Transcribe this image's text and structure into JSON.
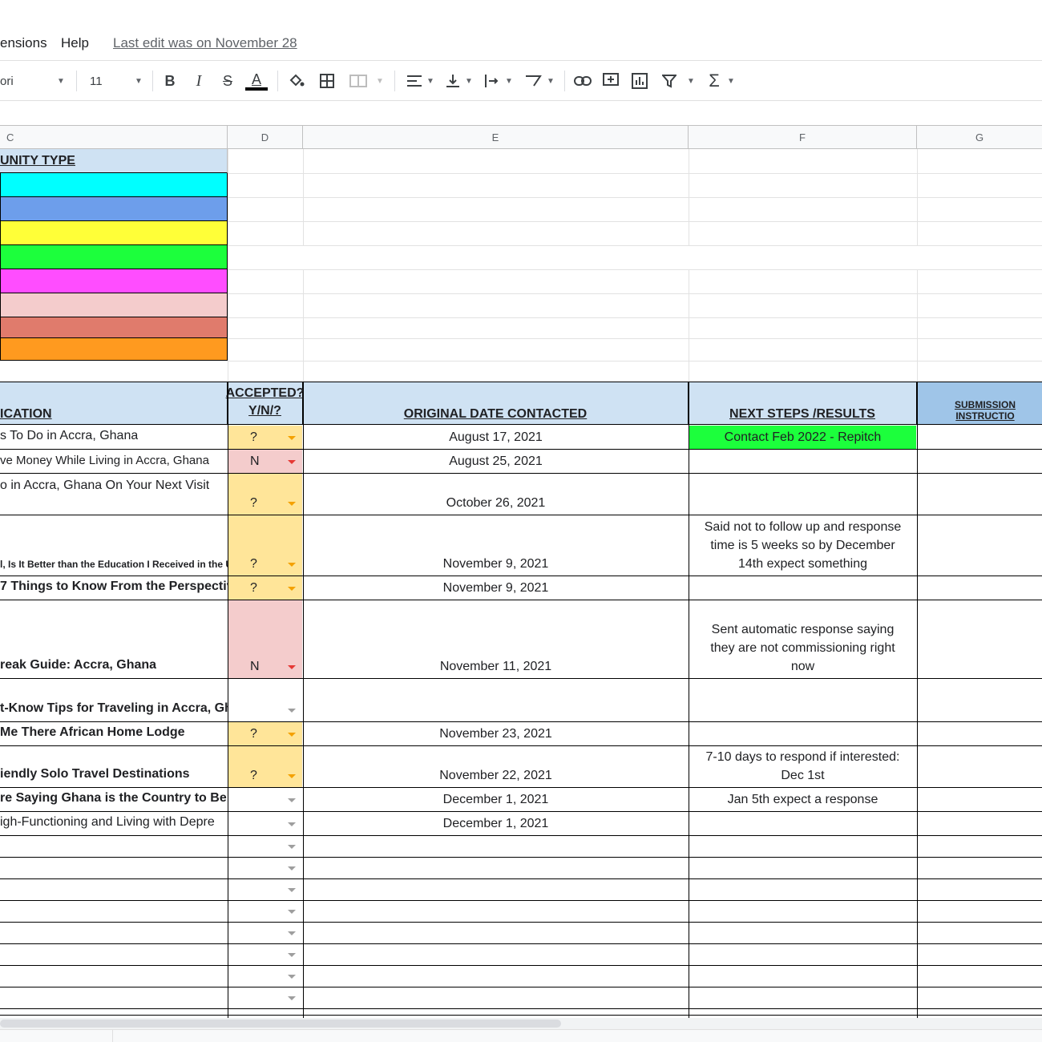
{
  "menu": {
    "extensions": "ensions",
    "help": "Help",
    "last_edit": "Last edit was on November 28"
  },
  "toolbar": {
    "font": "ori",
    "font_size": "11",
    "bold": "B",
    "italic": "I",
    "strike": "S",
    "text_color": "A",
    "sum": "Σ"
  },
  "columns": [
    "C",
    "D",
    "E",
    "F",
    "G"
  ],
  "legend": {
    "header": "UNITY TYPE",
    "colors": [
      "#00ffff",
      "#6d9eeb",
      "#ffff38",
      "#1cff3c",
      "#ff4dff",
      "#f4cccc",
      "#e07b6c",
      "#ff9a1f"
    ]
  },
  "table_header": {
    "c": "ICATION",
    "d_line1": "ACCEPTED?",
    "d_line2": "Y/N/?",
    "e": "ORIGINAL DATE CONTACTED",
    "f": "NEXT STEPS /RESULTS",
    "g": "SUBMISSION INSTRUCTIO"
  },
  "rows": [
    {
      "c": "s To Do in Accra, Ghana",
      "d": "?",
      "e": "August 17, 2021",
      "f": "Contact Feb 2022 - Repitch"
    },
    {
      "c": "ve Money While Living in Accra, Ghana",
      "d": "N",
      "e": "August 25, 2021",
      "f": ""
    },
    {
      "c": "o in Accra, Ghana On Your Next Visit",
      "d": "?",
      "e": "October 26, 2021",
      "f": ""
    },
    {
      "c": "l, Is It Better than the Education I Received in the U",
      "d": "?",
      "e": "November 9, 2021",
      "f1": "Said not to follow up and response",
      "f2": "time is 5 weeks so by December",
      "f3": "14th expect something"
    },
    {
      "c": "7 Things to Know From the Perspectiv",
      "d": "?",
      "e": "November 9, 2021",
      "f": ""
    },
    {
      "c": "reak Guide: Accra, Ghana",
      "d": "N",
      "e": "November 11, 2021",
      "f1": "Sent automatic response saying",
      "f2": "they are not commissioning right",
      "f3": "now"
    },
    {
      "c": "t-Know Tips for Traveling in Accra, Gh",
      "d": "",
      "e": "",
      "f": ""
    },
    {
      "c": " Me There African Home Lodge",
      "d": "?",
      "e": "November 23, 2021",
      "f": ""
    },
    {
      "c": "iendly Solo Travel Destinations",
      "d": "?",
      "e": "November 22, 2021",
      "f1": "7-10 days to respond if interested:",
      "f2": "Dec 1st"
    },
    {
      "c": "re Saying Ghana is the Country to Be",
      "d": "",
      "e": "December 1, 2021",
      "f": "Jan 5th expect a response"
    },
    {
      "c": "igh-Functioning and Living with Depre",
      "d": "",
      "e": "December 1, 2021",
      "f": ""
    }
  ]
}
